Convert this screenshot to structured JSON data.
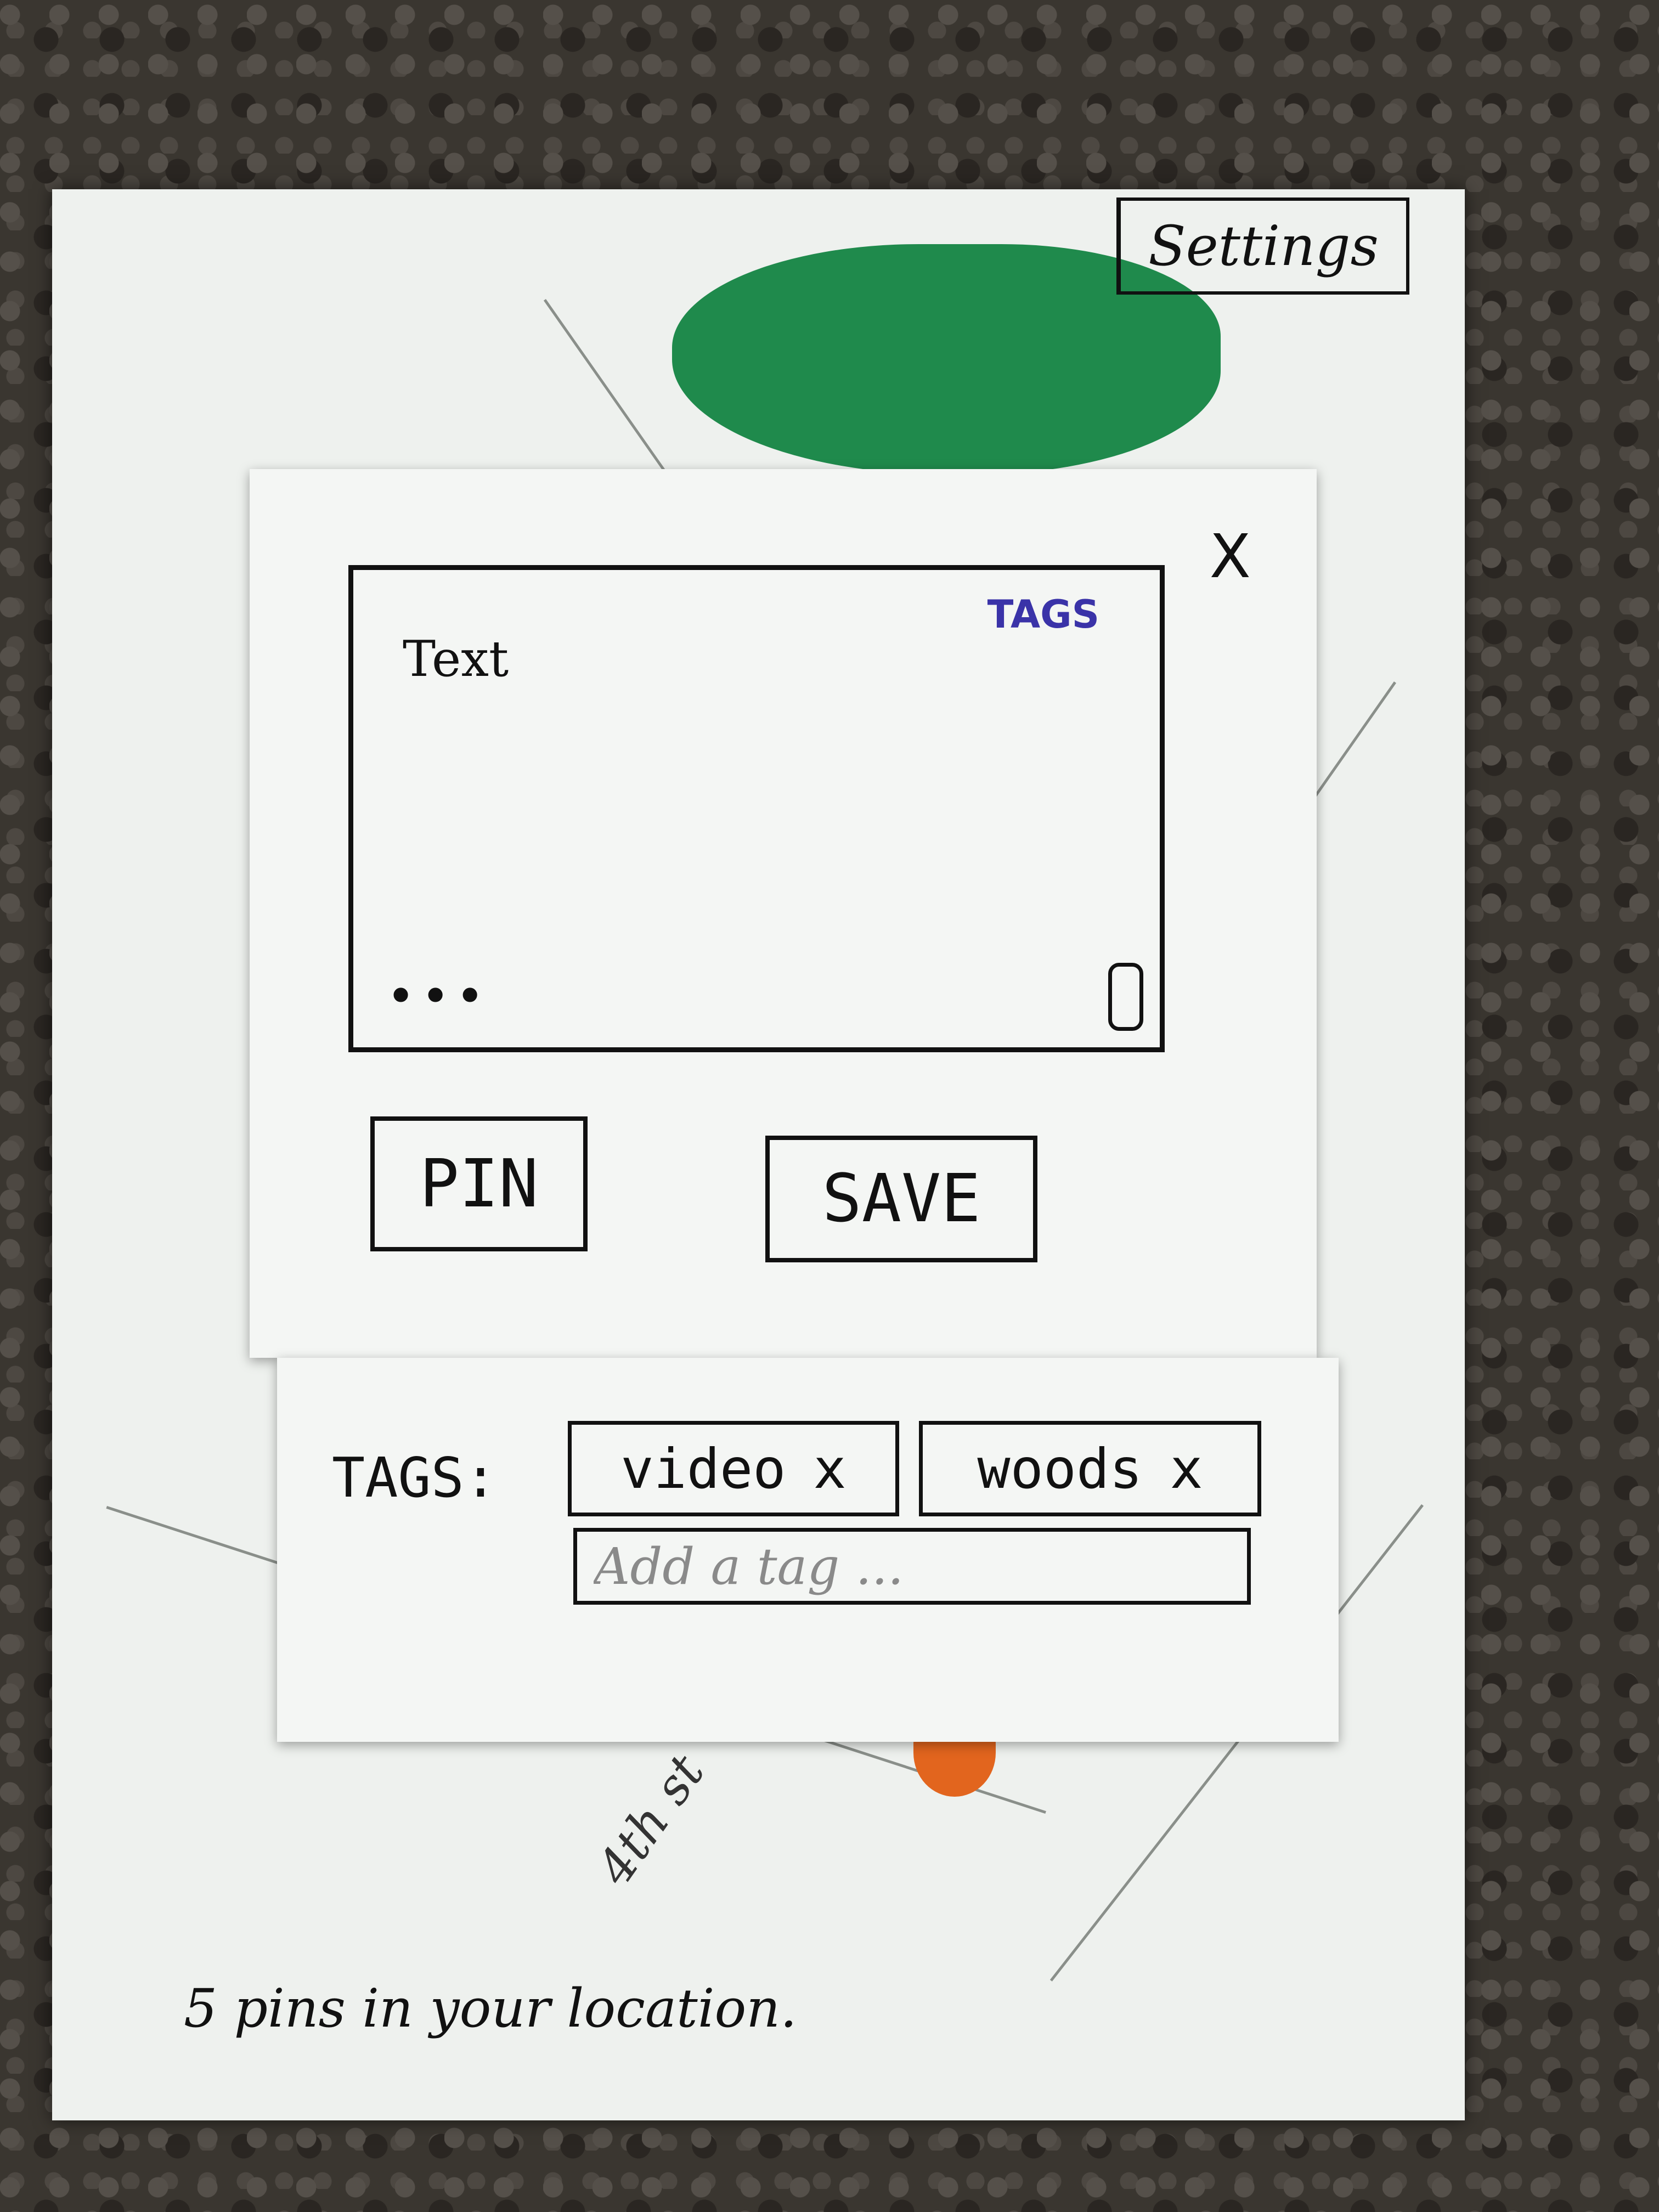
{
  "header": {
    "settings_label": "Settings"
  },
  "modal": {
    "close_glyph": "X",
    "text_placeholder": "Text",
    "tags_link": "TAGS",
    "more_glyph": "•••",
    "pin_label": "PIN",
    "save_label": "SAVE"
  },
  "tags_panel": {
    "title": "TAGS:",
    "tags": [
      {
        "label": "video",
        "remove": "x"
      },
      {
        "label": "woods",
        "remove": "x"
      }
    ],
    "add_placeholder": "Add a tag ..."
  },
  "map": {
    "street_label": "4th st"
  },
  "status": {
    "pins_text": "5 pins in your location."
  },
  "colors": {
    "accent_blue": "#3a33a8",
    "map_green": "#1f8a4c",
    "pin_orange": "#e2651e"
  }
}
